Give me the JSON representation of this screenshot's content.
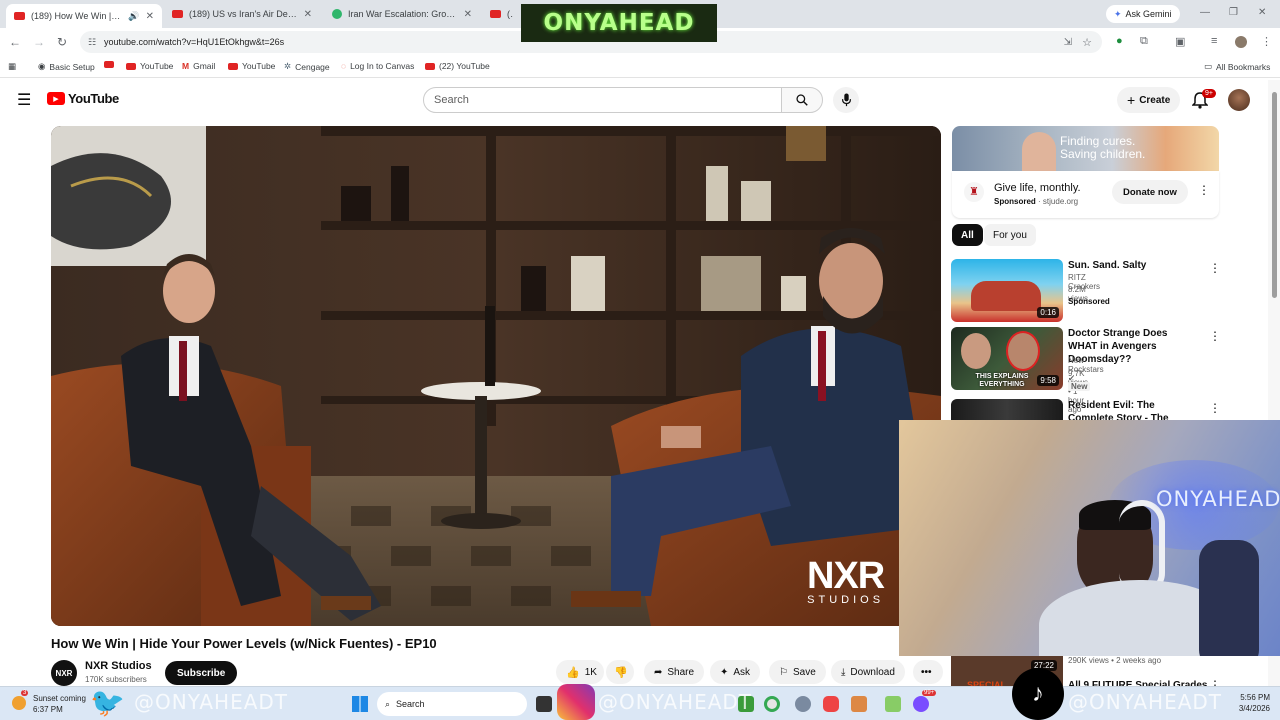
{
  "tabs": [
    {
      "title": "(189) How We Win | Hide Yo",
      "kind": "youtube",
      "active": true
    },
    {
      "title": "(189) US vs Iran's Air Defenses:",
      "kind": "youtube"
    },
    {
      "title": "Iran War Escalation: Ground Inv",
      "kind": "other"
    },
    {
      "title": "(189) MI...",
      "kind": "youtube"
    }
  ],
  "browser": {
    "ask_gemini": "Ask Gemini",
    "url": "youtube.com/watch?v=HqU1EtOkhgw&t=26s"
  },
  "bookmarks": [
    "Basic Setup",
    "YouTube",
    "Gmail",
    "YouTube",
    "Cengage",
    "Log In to Canvas",
    "(22) YouTube"
  ],
  "all_bookmarks": "All Bookmarks",
  "youtube": {
    "logo": "YouTube",
    "search_placeholder": "Search",
    "create_label": "Create",
    "notif_count": "9+"
  },
  "video": {
    "title": "How We Win | Hide Your Power Levels (w/Nick Fuentes) - EP10",
    "watermark_top": "NXR",
    "watermark_bottom": "STUDIOS",
    "channel": "NXR Studios",
    "channel_avatar_text": "NXR",
    "subscribers": "170K subscribers",
    "subscribe_label": "Subscribe",
    "likes": "1K",
    "share_label": "Share",
    "ask_label": "Ask",
    "save_label": "Save",
    "download_label": "Download"
  },
  "ad": {
    "banner_text": "Finding cures. Saving children.",
    "title": "Give life, monthly.",
    "sponsored": "Sponsored",
    "domain": "stjude.org",
    "cta": "Donate now"
  },
  "chips": [
    "All",
    "For you"
  ],
  "recommendations": [
    {
      "title": "Sun. Sand. Salty",
      "channel": "RITZ Crackers",
      "meta": "8.2M views",
      "badge": "Sponsored",
      "duration": "0:16"
    },
    {
      "title": "Doctor Strange Does WHAT in Avengers Doomsday??",
      "channel": "New Rockstars",
      "meta": "9.7K views • 1 hour ago",
      "badge": "New",
      "duration": "9:58",
      "thumb_text": "THIS EXPLAINS EVERYTHING"
    },
    {
      "title": "Resident Evil: The Complete Story - The Definitive Recap",
      "channel": "",
      "meta": "",
      "badge": "",
      "duration": ""
    }
  ],
  "hidden_rec": {
    "duration": "27:22",
    "meta": "290K views • 2 weeks ago",
    "title": "All 9 FUTURE Special Grades",
    "thumb_text": "SPECIAL"
  },
  "overlay": {
    "top_logo": "ONYAHEAD",
    "cam_logo": "ONYAHEAD",
    "handle": "@ONYAHEADT"
  },
  "taskbar": {
    "weather_title": "Sunset coming",
    "weather_time": "6:37 PM",
    "weather_badge": "3",
    "search_label": "Search",
    "time": "5:56 PM",
    "date": "3/4/2026",
    "chat_badge": "99+"
  }
}
